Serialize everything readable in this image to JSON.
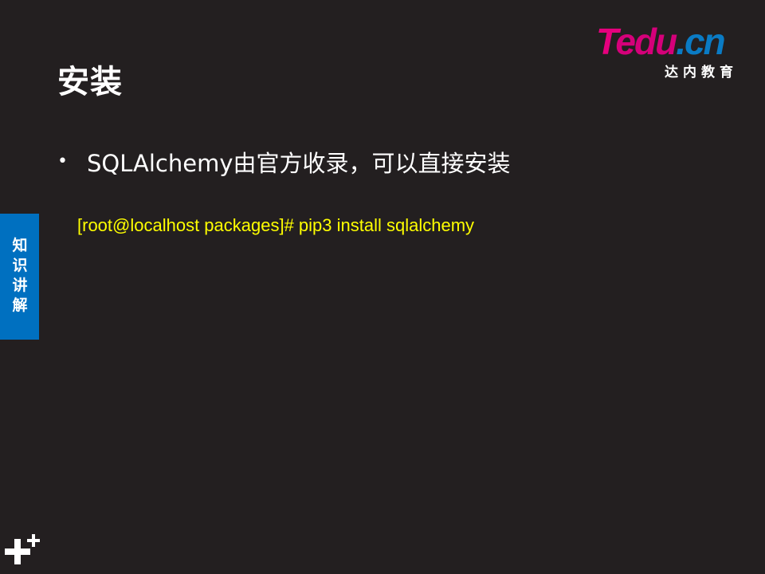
{
  "slide": {
    "title": "安装",
    "bullet_symbol": "•",
    "bullet_text": "SQLAlchemy由官方收录，可以直接安装",
    "command": "[root@localhost packages]# pip3 install sqlalchemy"
  },
  "logo": {
    "letter_t": "T",
    "text_edu": "edu",
    "text_cn": ".cn",
    "subtitle": "达内教育"
  },
  "side_tab": {
    "label": "知识讲解"
  },
  "colors": {
    "background": "#231f20",
    "title": "#ffffff",
    "command": "#ffff00",
    "side_tab": "#0070c0",
    "logo_magenta": "#e6007e",
    "logo_blue": "#0a7bc4"
  },
  "icons": {
    "corner": "plus-icon"
  }
}
